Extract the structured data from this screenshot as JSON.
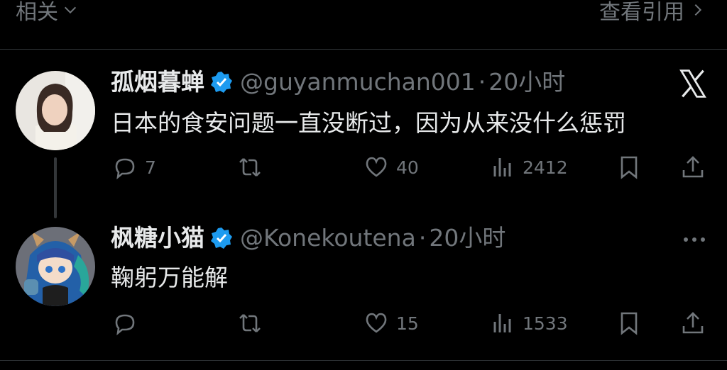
{
  "topbar": {
    "related_label": "相关",
    "quote_label": "查看引用"
  },
  "tweets": [
    {
      "name": "孤烟暮蝉",
      "handle": "@guyanmuchan001",
      "separator": "·",
      "time": "20小时",
      "text": "日本的食安问题一直没断过，因为从来没什么惩罚",
      "replies": "7",
      "retweets": "",
      "likes": "40",
      "views": "2412"
    },
    {
      "name": "枫糖小猫",
      "handle": "@Konekoutena",
      "separator": "·",
      "time": "20小时",
      "text": "鞠躬万能解",
      "replies": "",
      "retweets": "",
      "likes": "15",
      "views": "1533"
    }
  ],
  "colors": {
    "accent": "#1d9bf0",
    "muted": "#71767b",
    "text": "#e7e9ea",
    "background": "#000000"
  }
}
